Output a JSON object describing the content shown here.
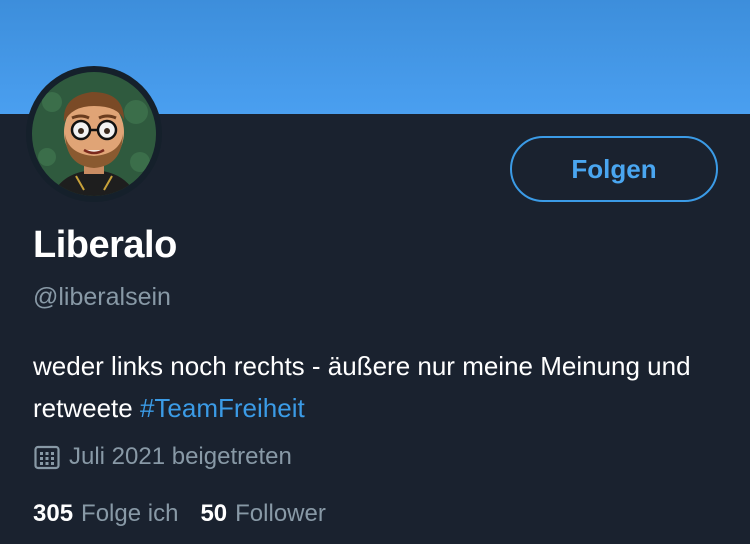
{
  "profile": {
    "name": "Liberalo",
    "handle": "@liberalsein",
    "bio_text": "weder links noch rechts - äußere nur meine Meinung und retweete ",
    "bio_hashtag": "#TeamFreiheit",
    "joined": "Juli 2021 beigetreten",
    "avatar_icon": "bitmoji-avatar"
  },
  "actions": {
    "follow_label": "Folgen"
  },
  "stats": {
    "following_count": "305",
    "following_label": "Folge ich",
    "followers_count": "50",
    "followers_label": "Follower"
  },
  "colors": {
    "banner": "#4a9ff0",
    "background": "#1a222f",
    "accent": "#3b9be6",
    "secondary_text": "#8899a6"
  },
  "icons": {
    "calendar": "calendar-icon"
  }
}
